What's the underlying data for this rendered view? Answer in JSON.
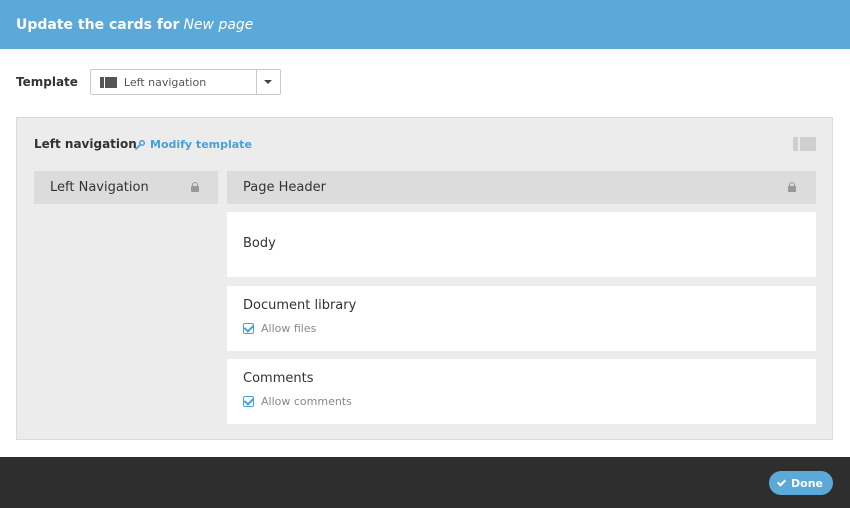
{
  "header": {
    "title_prefix": "Update the cards for",
    "page_name": "New page"
  },
  "template": {
    "label": "Template",
    "selected": "Left navigation",
    "icon": "left-navigation-layout-icon"
  },
  "panel": {
    "title": "Left navigation",
    "modify_label": "Modify template",
    "modify_icon": "wrench-icon",
    "layout_icon": "left-navigation-layout-icon"
  },
  "cards": {
    "left_nav": {
      "label": "Left Navigation",
      "locked": true
    },
    "page_header": {
      "label": "Page Header",
      "locked": true
    },
    "body": {
      "label": "Body"
    },
    "document_library": {
      "label": "Document library",
      "option": "Allow files",
      "checked": true
    },
    "comments": {
      "label": "Comments",
      "option": "Allow comments",
      "checked": true
    }
  },
  "footer": {
    "done_label": "Done",
    "done_icon": "checkmark-icon"
  },
  "colors": {
    "accent": "#5aa9d9",
    "link": "#4aa0d8",
    "footer_bg": "#2e2e2e",
    "panel_bg": "#ececec",
    "locked_card_bg": "#dcdcdc"
  }
}
